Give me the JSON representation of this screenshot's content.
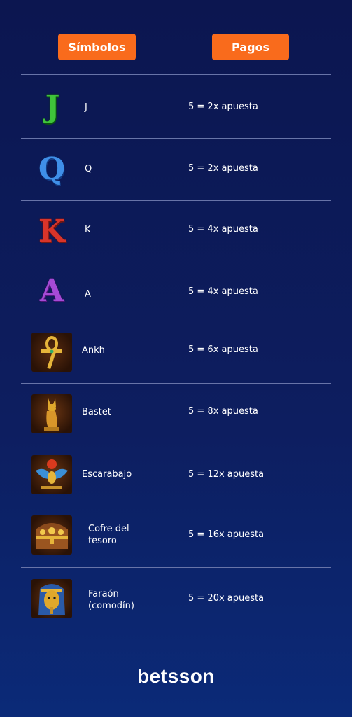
{
  "header": {
    "symbols_label": "Símbolos",
    "payouts_label": "Pagos"
  },
  "rows": [
    {
      "name": "J",
      "payout": "5 = 2x apuesta",
      "icon": "letter-j-icon"
    },
    {
      "name": "Q",
      "payout": "5 = 2x apuesta",
      "icon": "letter-q-icon"
    },
    {
      "name": "K",
      "payout": "5 = 4x apuesta",
      "icon": "letter-k-icon"
    },
    {
      "name": "A",
      "payout": "5 = 4x apuesta",
      "icon": "letter-a-icon"
    },
    {
      "name": "Ankh",
      "payout": "5 = 6x apuesta",
      "icon": "ankh-icon"
    },
    {
      "name": "Bastet",
      "payout": "5 = 8x apuesta",
      "icon": "bastet-cat-icon"
    },
    {
      "name": "Escarabajo",
      "payout": "5 = 12x apuesta",
      "icon": "scarab-icon"
    },
    {
      "name_line1": "Cofre del",
      "name_line2": "tesoro",
      "payout": "5 = 16x apuesta",
      "icon": "treasure-chest-icon"
    },
    {
      "name_line1": "Faraón",
      "name_line2": "(comodín)",
      "payout": "5 = 20x apuesta",
      "icon": "pharaoh-mask-icon"
    }
  ],
  "brand": {
    "logo_text": "betsson"
  },
  "colors": {
    "accent": "#f96b1c",
    "background_top": "#0c1650",
    "background_bottom": "#0b2a78",
    "divider": "#6874a8"
  }
}
